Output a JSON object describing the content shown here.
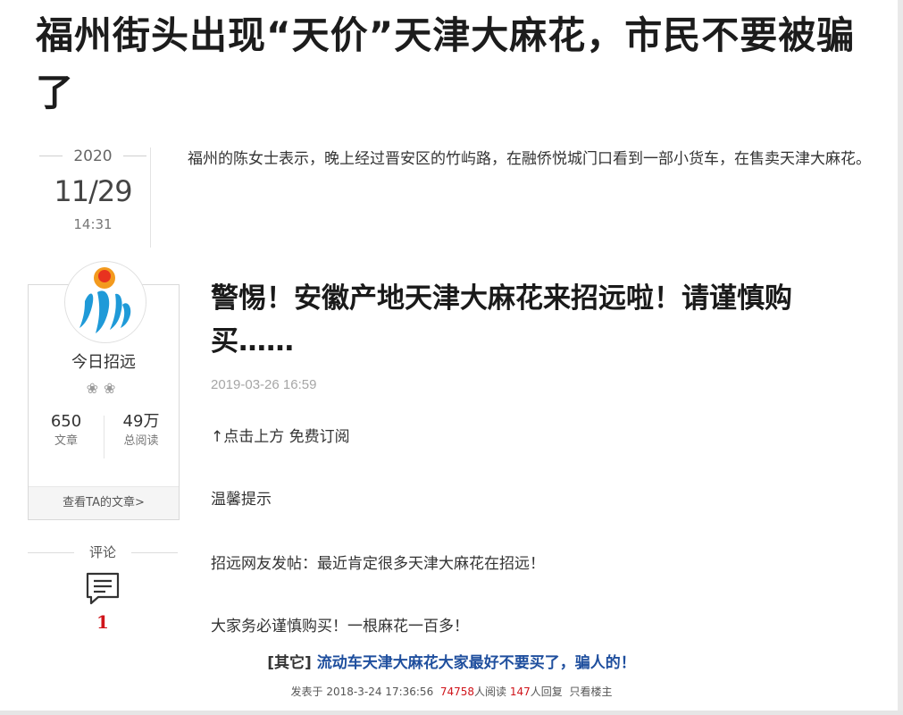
{
  "headline": "福州街头出现“天价”天津大麻花，市民不要被骗了",
  "post_date": {
    "year": "2020",
    "day": "11/29",
    "time": "14:31"
  },
  "intro": "福州的陈女士表示，晚上经过晋安区的竹屿路，在融侨悦城门口看到一部小货车，在售卖天津大麻花。",
  "profile": {
    "name": "今日招远",
    "badges": "❀❀",
    "articles_count": "650",
    "articles_label": "文章",
    "reads_count": "49万",
    "reads_label": "总阅读",
    "view_link": "查看TA的文章>"
  },
  "comments": {
    "title": "评论",
    "count": "1"
  },
  "article": {
    "title": "警惕！安徽产地天津大麻花来招远啦！请谨慎购买……",
    "date": "2019-03-26 16:59",
    "paragraphs": [
      "↑点击上方 免费订阅",
      "温馨提示",
      "招远网友发帖：最近肯定很多天津大麻花在招远！",
      "大家务必谨慎购买！一根麻花一百多！"
    ]
  },
  "forum_post": {
    "category": "[其它]",
    "title": "流动车天津大麻花大家最好不要买了，骗人的！",
    "posted_prefix": "发表于",
    "posted_time": "2018-3-24 17:36:56",
    "reads": "74758",
    "reads_suffix": "人阅读",
    "replies": "147",
    "replies_suffix": "人回复",
    "author_only": "只看楼主"
  },
  "colors": {
    "accent_red": "#d0141a",
    "link_blue": "#1f4f9e",
    "muted_gray": "#a6a6a6"
  },
  "icons": {
    "comment": "comment-icon",
    "avatar": "logo-avatar-icon"
  }
}
